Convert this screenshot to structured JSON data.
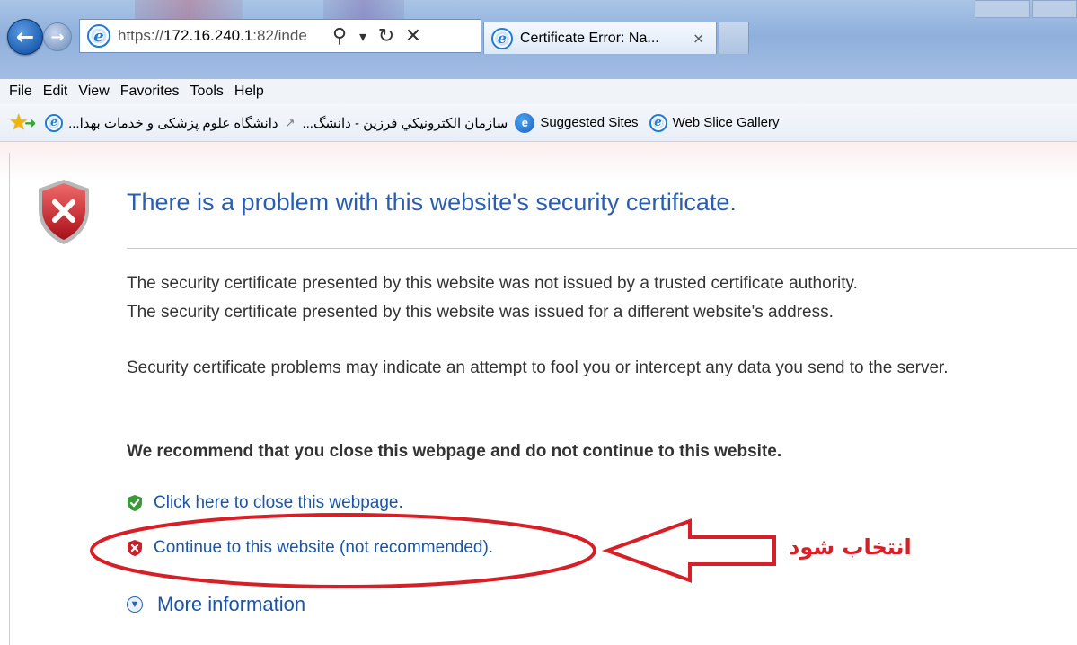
{
  "browser": {
    "address_url": "https://172.16.240.1:82/inde",
    "url_scheme": "https://",
    "url_host": "172.16.240.1",
    "url_rest": ":82/inde",
    "active_tab_title": "Certificate Error: Na...",
    "tab_close": "×",
    "search_glyph": "⚲",
    "dropdown_glyph": "▾",
    "refresh_glyph": "↻",
    "stop_glyph": "✕"
  },
  "menu": [
    "File",
    "Edit",
    "View",
    "Favorites",
    "Tools",
    "Help"
  ],
  "favorites": {
    "items": [
      "دانشگاه علوم پزشکی و خدمات بهدا...",
      "سازمان الکترونیکي فرزین - دانشگ...",
      "Suggested Sites",
      "Web Slice Gallery"
    ]
  },
  "page": {
    "headline": "There is a problem with this website's security certificate.",
    "paragraph1_line1": "The security certificate presented by this website was not issued by a trusted certificate authority.",
    "paragraph1_line2": "The security certificate presented by this website was issued for a different website's address.",
    "paragraph2": "Security certificate problems may indicate an attempt to fool you or intercept any data you send to the server.",
    "recommendation": "We recommend that you close this webpage and do not continue to this website.",
    "close_link": "Click here to close this webpage.",
    "continue_link": "Continue to this website (not recommended).",
    "more_info": "More information"
  },
  "annotation": {
    "label": "انتخاب شود",
    "color": "#d61f26"
  },
  "colors": {
    "headline": "#2a5db0",
    "link": "#1a55a8",
    "error_red": "#c8212a",
    "ok_green": "#3a9a3a"
  }
}
